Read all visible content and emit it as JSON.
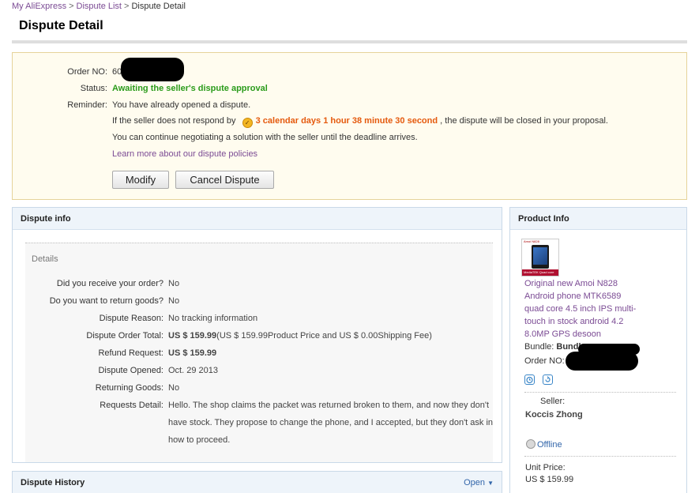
{
  "breadcrumb": {
    "item1": "My AliExpress",
    "sep1": ">",
    "item2": "Dispute List",
    "sep2": ">",
    "current": "Dispute Detail"
  },
  "page_title": "Dispute Detail",
  "status_box": {
    "order_no_label": "Order NO:",
    "order_no_visible": "60",
    "status_label": "Status:",
    "status_value": "Awaiting the seller's dispute approval",
    "reminder_label": "Reminder:",
    "reminder_text": "You have already opened a dispute.",
    "countdown_prefix": "If the seller does not respond by",
    "countdown_value": "3 calendar days 1 hour 38 minute 30 second",
    "countdown_suffix": ", the dispute will be closed in your proposal.",
    "negotiate_text": "You can continue negotiating a solution with the seller until the deadline arrives.",
    "learn_more": "Learn more about our dispute policies",
    "modify_button": "Modify",
    "cancel_button": "Cancel Dispute"
  },
  "dispute_info": {
    "header": "Dispute info",
    "section": "Details",
    "rows": [
      {
        "label": "Did you receive your order?",
        "value": "No"
      },
      {
        "label": "Do you want to return goods?",
        "value": "No"
      },
      {
        "label": "Dispute Reason:",
        "value": "No tracking information"
      },
      {
        "label": "Dispute Order Total:",
        "value_bold": "US $ 159.99",
        "value": "(US $ 159.99Product Price and US $ 0.00Shipping Fee)"
      },
      {
        "label": "Refund Request:",
        "value": "US $ 159.99"
      },
      {
        "label": "Dispute Opened:",
        "value": "Oct. 29 2013"
      },
      {
        "label": "Returning Goods:",
        "value": "No"
      },
      {
        "label": "Requests Detail:",
        "lines": [
          "Hello. The shop claims the packet was returned broken to them, and now they don't",
          "have stock. They propose to change the phone, and I accepted, but they don't ask in",
          "how to proceed."
        ]
      }
    ]
  },
  "dispute_history": {
    "header": "Dispute History",
    "toggle": "Open"
  },
  "product_info": {
    "header": "Product Info",
    "thumb_caption_top": "Amoi N828",
    "thumb_caption_bottom": "MediaTEK Quad core",
    "title_lines": [
      "Original new Amoi N828",
      "Android phone MTK6589",
      "quad core 4.5 inch IPS multi-",
      "touch in stock android 4.2",
      "8.0MP GPS desoon"
    ],
    "bundle_label": "Bundle:",
    "bundle_value": "Bundle",
    "order_label": "Order NO:",
    "seller_label": "Seller:",
    "seller_name": "Koccis Zhong",
    "status": "Offline",
    "unit_price_label": "Unit Price:",
    "unit_price": "US $ 159.99"
  },
  "colors": {
    "status_green": "#2a9b1a",
    "countdown_orange": "#e55a0e",
    "link_purple": "#7b4b94",
    "panel_header_bg": "#eef4fa"
  }
}
